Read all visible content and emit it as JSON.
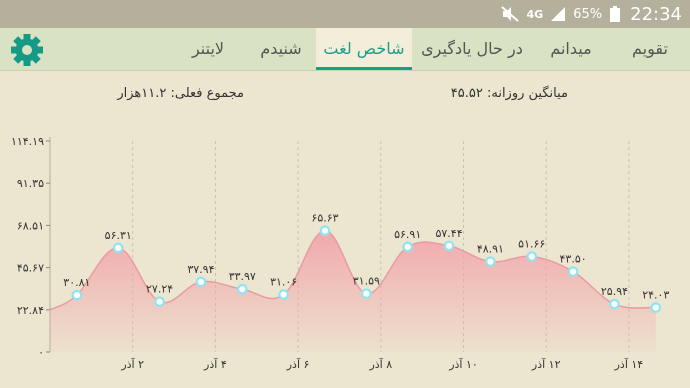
{
  "status_bar": {
    "mute_icon": "mute-icon",
    "network": "4G",
    "battery_percent": "65%",
    "time": "22:34"
  },
  "tabs": [
    {
      "label": "تقویم",
      "active": false
    },
    {
      "label": "میدانم",
      "active": false
    },
    {
      "label": "در حال یادگیری",
      "active": false
    },
    {
      "label": "شاخص لغت",
      "active": true
    },
    {
      "label": "شنیدم",
      "active": false
    },
    {
      "label": "لایتنر",
      "active": false
    }
  ],
  "settings_icon": "gear-icon",
  "accent_color": "#1a9e8a",
  "summary": {
    "daily_average": "میانگین روزانه: ۴۵.۵۲",
    "total": "مجموع فعلی: ۱۱.۲هزار"
  },
  "chart_data": {
    "type": "area",
    "y_ticks": [
      "۱۱۴.۱۹",
      "۹۱.۳۵",
      "۶۸.۵۱",
      "۴۵.۶۷",
      "۲۲.۸۴",
      "۰"
    ],
    "ylim": [
      0,
      114.19
    ],
    "x_tick_labels": [
      "۲ آذر",
      "۴ آذر",
      "۶ آذر",
      "۸ آذر",
      "۱۰ آذر",
      "۱۲ آذر",
      "۱۴ آذر"
    ],
    "x_tick_positions": [
      2,
      4,
      6,
      8,
      10,
      12,
      14
    ],
    "x_range": [
      0.0,
      14.8
    ],
    "series": [
      {
        "x": [
          0.0,
          0.65,
          1.65,
          2.65,
          3.65,
          4.65,
          5.65,
          6.65,
          7.65,
          8.65,
          9.65,
          10.65,
          11.65,
          12.65,
          13.65,
          14.65
        ],
        "values": [
          22.84,
          30.81,
          56.31,
          27.24,
          37.94,
          33.97,
          31.06,
          65.63,
          31.59,
          56.91,
          57.44,
          48.91,
          51.66,
          43.5,
          25.94,
          24.03
        ],
        "point_labels": [
          "",
          "۳۰.۸۱",
          "۵۶.۳۱",
          "۲۷.۲۴",
          "۳۷.۹۴",
          "۳۳.۹۷",
          "۳۱.۰۶",
          "۶۵.۶۳",
          "۳۱.۵۹",
          "۵۶.۹۱",
          "۵۷.۴۴",
          "۴۸.۹۱",
          "۵۱.۶۶",
          "۴۳.۵۰",
          "۲۵.۹۴",
          "۲۴.۰۳"
        ],
        "marker_from": 1
      }
    ],
    "grid": "vertical-dashed",
    "area_color": "#f2a5ab",
    "line_color": "#ea9aa3",
    "marker_color": "#8fe4f4"
  }
}
